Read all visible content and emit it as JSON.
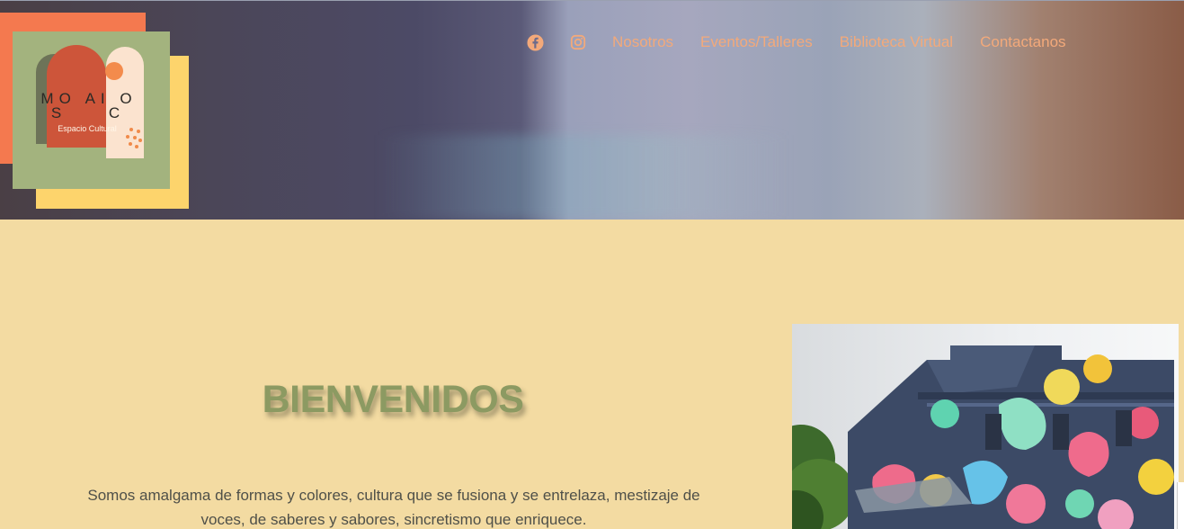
{
  "brand": {
    "logo_word_top": "MO AI O",
    "logo_word_bottom": "S C",
    "logo_subtitle": "Espacio Cultural",
    "colors": {
      "orange": "#f4794f",
      "yellow": "#fdd46c",
      "green": "#a3b37e",
      "rust": "#cd553a",
      "cream": "#fbe3cf"
    }
  },
  "nav": {
    "icons": [
      "facebook-icon",
      "instagram-icon"
    ],
    "links": [
      "Nosotros",
      "Eventos/Talleres",
      "Biblioteca Virtual",
      "Contactanos"
    ],
    "link_color": "#f3a97a"
  },
  "main": {
    "title": "BIENVENIDOS",
    "intro_line1": "Somos amalgama de formas y colores, cultura que se fusiona y se entrelaza, mestizaje de",
    "intro_line2": "voces, de saberes y sabores, sincretismo que enriquece.",
    "background": "#f3dba2",
    "title_color": "#8c9a62"
  },
  "photo": {
    "subject": "mural-covered building"
  }
}
